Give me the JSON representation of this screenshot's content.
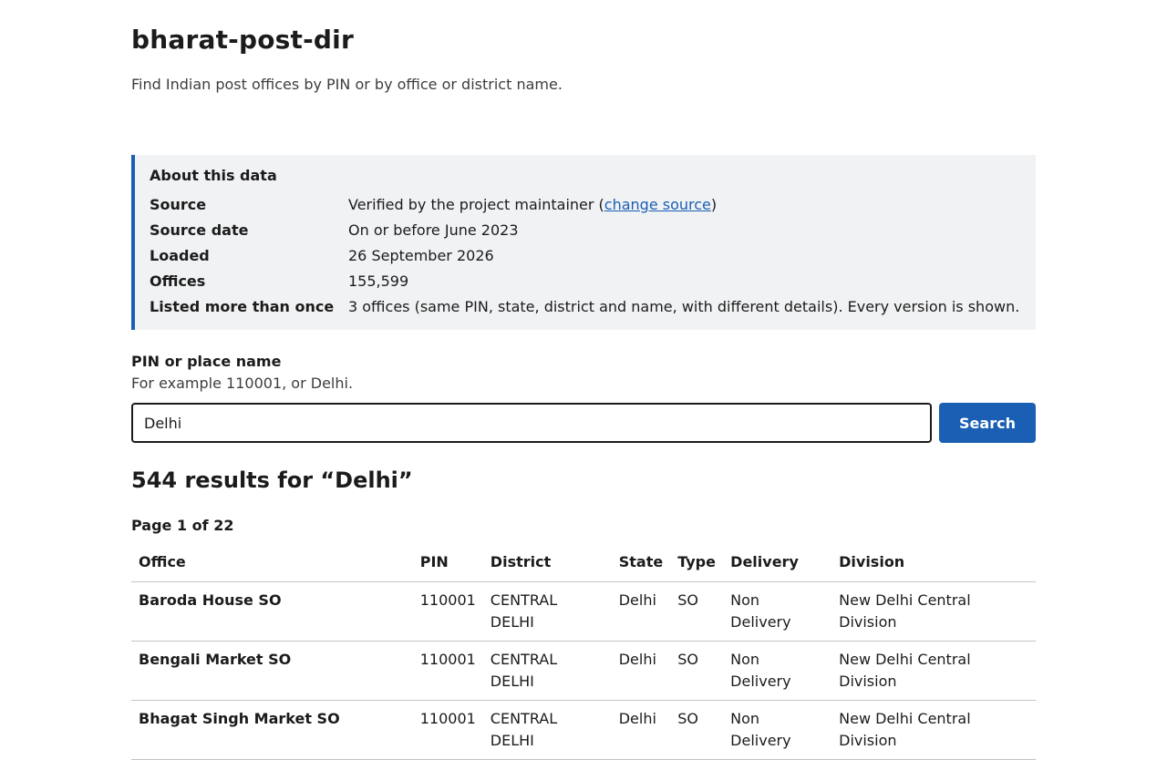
{
  "header": {
    "title": "bharat-post-dir",
    "tagline": "Find Indian post offices by PIN or by office or district name."
  },
  "about": {
    "title": "About this data",
    "rows": [
      {
        "label": "Source",
        "value_before": "Verified by the project maintainer (",
        "link": "change source",
        "value_after": ")"
      },
      {
        "label": "Source date",
        "value": "On or before June 2023"
      },
      {
        "label": "Loaded",
        "value": "26 September 2026"
      },
      {
        "label": "Offices",
        "value": "155,599"
      },
      {
        "label": "Listed more than once",
        "value": "3 offices (same PIN, state, district and name, with different details). Every version is shown."
      }
    ]
  },
  "search": {
    "label": "PIN or place name",
    "hint": "For example 110001, or Delhi.",
    "value": "Delhi",
    "button_label": "Search"
  },
  "results": {
    "heading": "544 results for “Delhi”",
    "page_indicator": "Page 1 of 22",
    "columns": [
      "Office",
      "PIN",
      "District",
      "State",
      "Type",
      "Delivery",
      "Division"
    ],
    "rows": [
      {
        "office": "Baroda House SO",
        "pin": "110001",
        "district": "CENTRAL DELHI",
        "state": "Delhi",
        "type": "SO",
        "delivery": "Non Delivery",
        "division": "New Delhi Central Division"
      },
      {
        "office": "Bengali Market SO",
        "pin": "110001",
        "district": "CENTRAL DELHI",
        "state": "Delhi",
        "type": "SO",
        "delivery": "Non Delivery",
        "division": "New Delhi Central Division"
      },
      {
        "office": "Bhagat Singh Market SO",
        "pin": "110001",
        "district": "CENTRAL DELHI",
        "state": "Delhi",
        "type": "SO",
        "delivery": "Non Delivery",
        "division": "New Delhi Central Division"
      }
    ]
  },
  "colors": {
    "accent": "#1a5fb4",
    "panel_background": "#f1f2f4",
    "text": "#1b1b1b"
  }
}
